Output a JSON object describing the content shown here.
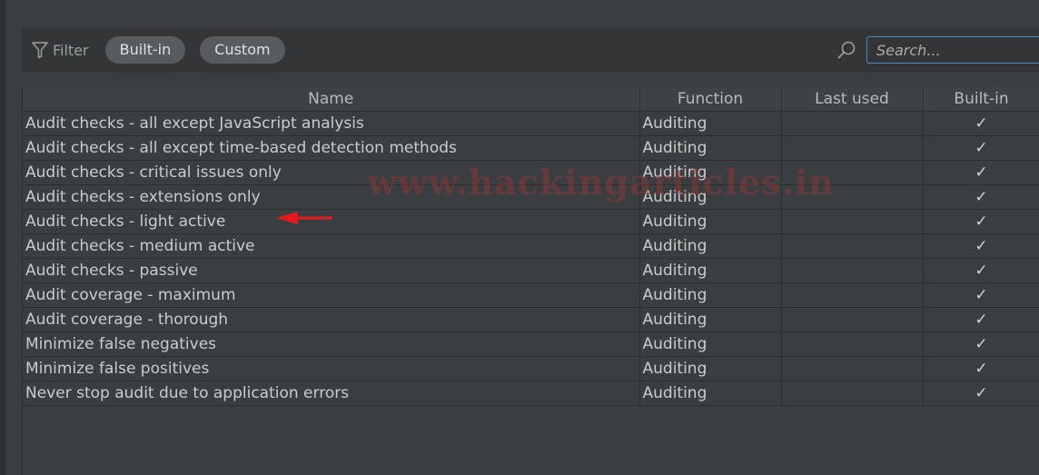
{
  "filter": {
    "label": "Filter",
    "pills": [
      "Built-in",
      "Custom"
    ],
    "search_placeholder": "Search..."
  },
  "table": {
    "headers": [
      "Name",
      "Function",
      "Last used",
      "Built-in"
    ],
    "rows": [
      {
        "name": "Audit checks - all except JavaScript analysis",
        "function": "Auditing",
        "last_used": "",
        "builtin": "✓"
      },
      {
        "name": "Audit checks - all except time-based detection methods",
        "function": "Auditing",
        "last_used": "",
        "builtin": "✓"
      },
      {
        "name": "Audit checks - critical issues only",
        "function": "Auditing",
        "last_used": "",
        "builtin": "✓"
      },
      {
        "name": "Audit checks - extensions only",
        "function": "Auditing",
        "last_used": "",
        "builtin": "✓"
      },
      {
        "name": "Audit checks - light active",
        "function": "Auditing",
        "last_used": "",
        "builtin": "✓"
      },
      {
        "name": "Audit checks - medium active",
        "function": "Auditing",
        "last_used": "",
        "builtin": "✓"
      },
      {
        "name": "Audit checks - passive",
        "function": "Auditing",
        "last_used": "",
        "builtin": "✓"
      },
      {
        "name": "Audit coverage - maximum",
        "function": "Auditing",
        "last_used": "",
        "builtin": "✓"
      },
      {
        "name": "Audit coverage - thorough",
        "function": "Auditing",
        "last_used": "",
        "builtin": "✓"
      },
      {
        "name": "Minimize false negatives",
        "function": "Auditing",
        "last_used": "",
        "builtin": "✓"
      },
      {
        "name": "Minimize false positives",
        "function": "Auditing",
        "last_used": "",
        "builtin": "✓"
      },
      {
        "name": "Never stop audit due to application errors",
        "function": "Auditing",
        "last_used": "",
        "builtin": "✓"
      }
    ]
  },
  "watermark": "www.hackingarticles.in",
  "colors": {
    "background": "#3b3e40",
    "accent_focus": "#4a88c7",
    "annotation_arrow": "#e8191c"
  },
  "icons": {
    "filter": "funnel-icon",
    "search": "magnifier-icon",
    "annotation": "red-arrow-icon"
  }
}
